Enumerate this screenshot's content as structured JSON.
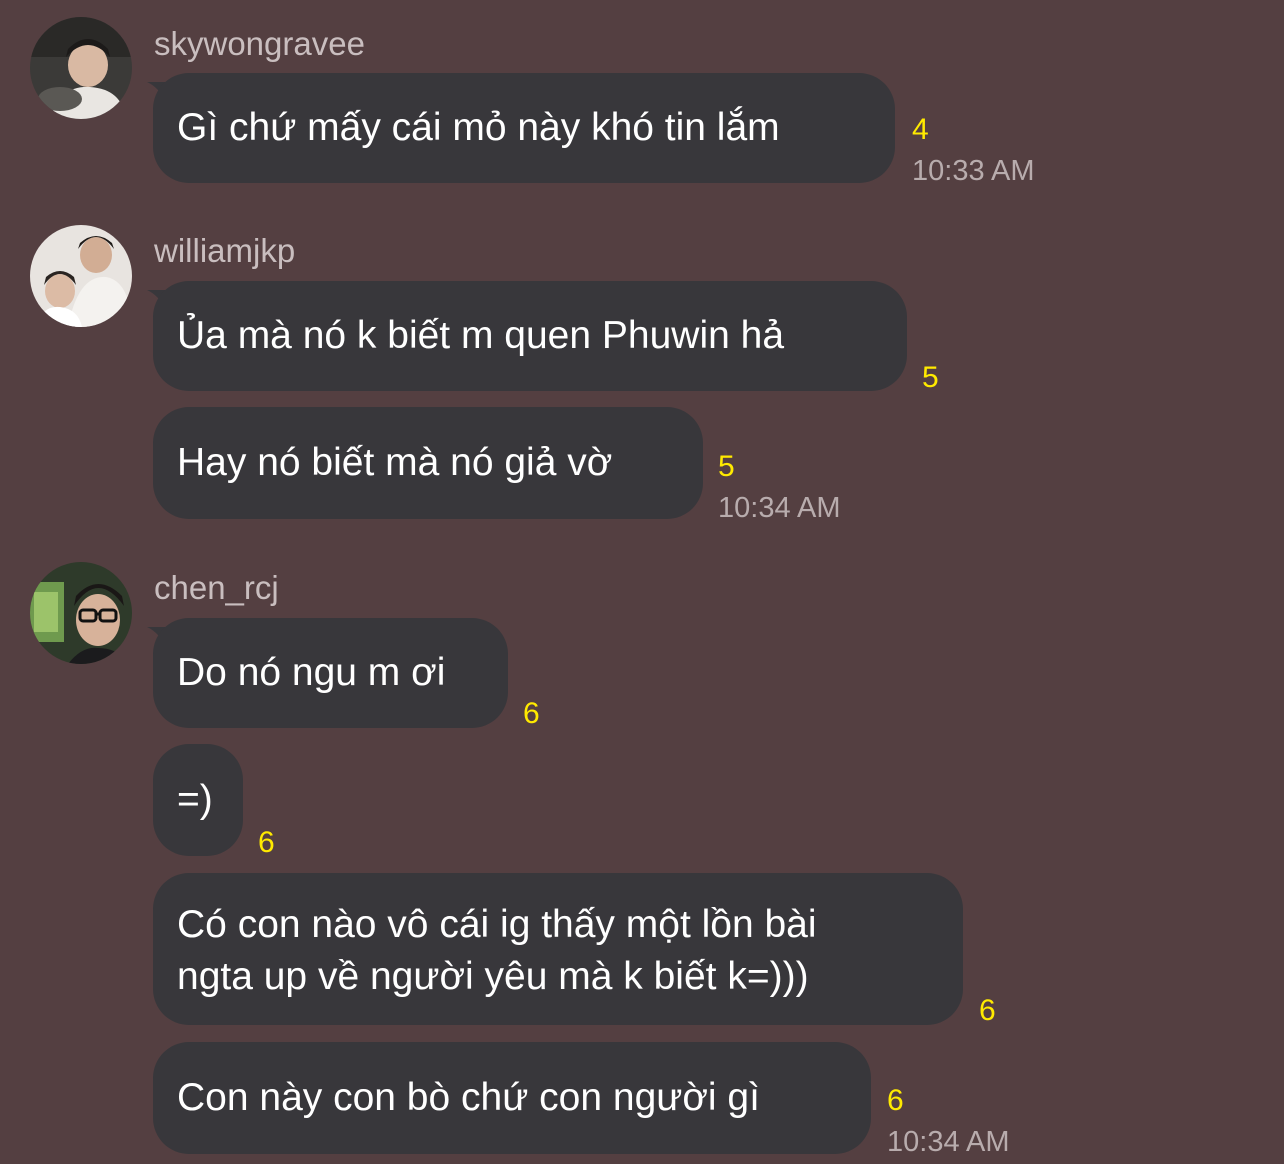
{
  "messages": [
    {
      "user": "skywongravee",
      "avatar_icon": "user-avatar-photo",
      "items": [
        {
          "text": "Gì chứ mấy cái mỏ này khó tin lắm",
          "count": "4",
          "time": "10:33 AM"
        }
      ]
    },
    {
      "user": "williamjkp",
      "avatar_icon": "user-avatar-photo",
      "items": [
        {
          "text": "Ủa mà nó k biết m quen Phuwin hả",
          "count": "5"
        },
        {
          "text": "Hay nó biết mà nó giả vờ",
          "count": "5",
          "time": "10:34 AM"
        }
      ]
    },
    {
      "user": "chen_rcj",
      "avatar_icon": "user-avatar-photo",
      "items": [
        {
          "text": "Do nó ngu m ơi",
          "count": "6"
        },
        {
          "text": "=)",
          "count": "6"
        },
        {
          "lines": [
            "Có con nào vô cái ig thấy một lồn bài",
            "ngta up về người yêu mà k biết k=)))"
          ],
          "count": "6"
        },
        {
          "text": "Con này con bò chứ con người gì",
          "count": "6",
          "time": "10:34 AM"
        }
      ]
    }
  ],
  "colors": {
    "background": "#543f41",
    "bubble": "#38373b",
    "count": "#ffea00",
    "meta_text": "#b8acad"
  }
}
